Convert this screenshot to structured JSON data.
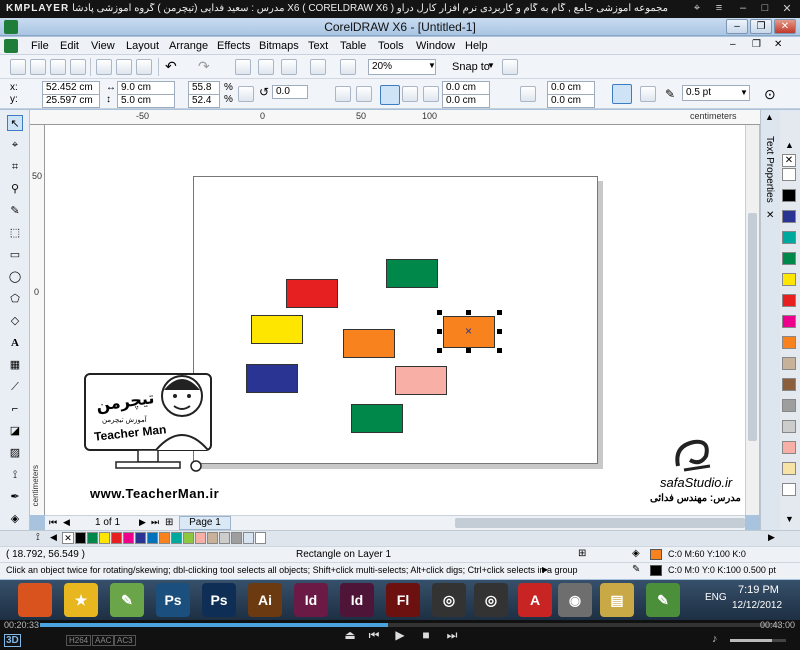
{
  "player": {
    "logo": "KMPLAYER",
    "title": "مجموعه آموزشی جامع , گام به گام و کاربردی نرم افزار کارل دراو X6 ( CORELDRAW X6 )   مدرس : سعید فدایی (تیچرمن ) گروه آموزشی پادشاه گرافیست ها",
    "time_elapsed": "00:20:33",
    "time_total": "00:43:00",
    "mode_3d": "3D",
    "codec_labels": [
      "H264",
      "AAC",
      "AC3"
    ],
    "progress_fraction": 0.47,
    "volume_fraction": 0.75
  },
  "window": {
    "title": "CorelDRAW X6 - [Untitled-1]"
  },
  "menu": [
    "File",
    "Edit",
    "View",
    "Layout",
    "Arrange",
    "Effects",
    "Bitmaps",
    "Text",
    "Table",
    "Tools",
    "Window",
    "Help"
  ],
  "toolbar": {
    "zoom": "20%",
    "snap_to": "Snap to"
  },
  "propbar": {
    "x_label": "x:",
    "y_label": "y:",
    "x": "52.452 cm",
    "y": "25.597 cm",
    "width": "9.0 cm",
    "height": "5.0 cm",
    "scale_w": "55.8",
    "scale_h": "52.4",
    "percent": "%",
    "angle": "0.0",
    "corner_tl": "0.0 cm",
    "corner_bl": "0.0 cm",
    "corner_tr": "0.0 cm",
    "corner_br": "0.0 cm",
    "outline": "0.5 pt"
  },
  "ruler": {
    "units": "centimeters",
    "h_ticks": [
      "-50",
      "0",
      "50",
      "100"
    ],
    "v_ticks": [
      "50",
      "0"
    ]
  },
  "docker": {
    "label": "Text Properties"
  },
  "page_nav": {
    "counter": "1 of 1",
    "tab": "Page 1"
  },
  "status": {
    "coords": "( 18.792, 56.549 )",
    "selection": "Rectangle on Layer 1",
    "fill": "C:0 M:60 Y:100 K:0",
    "outline": "C:0 M:0 Y:0 K:100  0.500 pt",
    "hint": "Click an object twice for rotating/skewing; dbl-clicking tool selects all objects; Shift+click multi-selects; Alt+click digs; Ctrl+click selects in a group"
  },
  "watermark": {
    "teacher_sign": "تیچرمن",
    "teacher_sub": "آموزش تیچرمن",
    "teacher_name": "Teacher Man",
    "teacher_url": "www.TeacherMan.ir",
    "studio_url": "safaStudio.ir",
    "studio_author": "مدرس: مهندس فدائی"
  },
  "taskbar": {
    "lang": "ENG",
    "time": "7:19 PM",
    "date": "12/12/2012",
    "apps": [
      {
        "label": "",
        "color": "#d9531e"
      },
      {
        "label": "★",
        "color": "#e8b61e"
      },
      {
        "label": "✎",
        "color": "#6aa54a"
      },
      {
        "label": "Ps",
        "color": "#1b4f7e"
      },
      {
        "label": "Ps",
        "color": "#0f2e55"
      },
      {
        "label": "Ai",
        "color": "#6b3a10"
      },
      {
        "label": "Id",
        "color": "#6a1a45"
      },
      {
        "label": "Id",
        "color": "#4f1538"
      },
      {
        "label": "Fl",
        "color": "#6c1010"
      },
      {
        "label": "◎",
        "color": "#333333"
      },
      {
        "label": "◎",
        "color": "#333333"
      },
      {
        "label": "A",
        "color": "#c82424"
      },
      {
        "label": "◉",
        "color": "#6e6e6e"
      },
      {
        "label": "▤",
        "color": "#c9a846"
      },
      {
        "label": "✎",
        "color": "#4b8f3a"
      }
    ]
  },
  "shapes": [
    {
      "name": "green-rect-top",
      "color": "#00884a"
    },
    {
      "name": "red-rect",
      "color": "#e62020"
    },
    {
      "name": "yellow-rect",
      "color": "#ffe600"
    },
    {
      "name": "orange-rect-middle",
      "color": "#f7821e"
    },
    {
      "name": "orange-rect-selected",
      "color": "#f7821e"
    },
    {
      "name": "navy-rect",
      "color": "#2a3593"
    },
    {
      "name": "pink-rect",
      "color": "#f7afa6"
    },
    {
      "name": "green-rect-bottom",
      "color": "#00884a"
    }
  ],
  "palette_bottom": [
    "#000000",
    "#00884a",
    "#ffe600",
    "#e62020",
    "#ec008c",
    "#2a3593",
    "#0072bc",
    "#f7821e",
    "#00a99d",
    "#8dc63f",
    "#f7afa6",
    "#c7b299",
    "#cccccc",
    "#9e9e9e",
    "#d8e4f0",
    "#ffffff"
  ],
  "palette_right": [
    "#ffffff",
    "#000000",
    "#2a3593",
    "#00a99d",
    "#00884a",
    "#ffe600",
    "#e62020",
    "#ec008c",
    "#f7821e",
    "#c7b299",
    "#8b5e3c",
    "#9e9e9e",
    "#cccccc",
    "#f7afa6",
    "#f7e3a6",
    "#ffffff"
  ],
  "colors": {
    "selected_fill": "#f7821e",
    "outline_color": "#000000"
  }
}
